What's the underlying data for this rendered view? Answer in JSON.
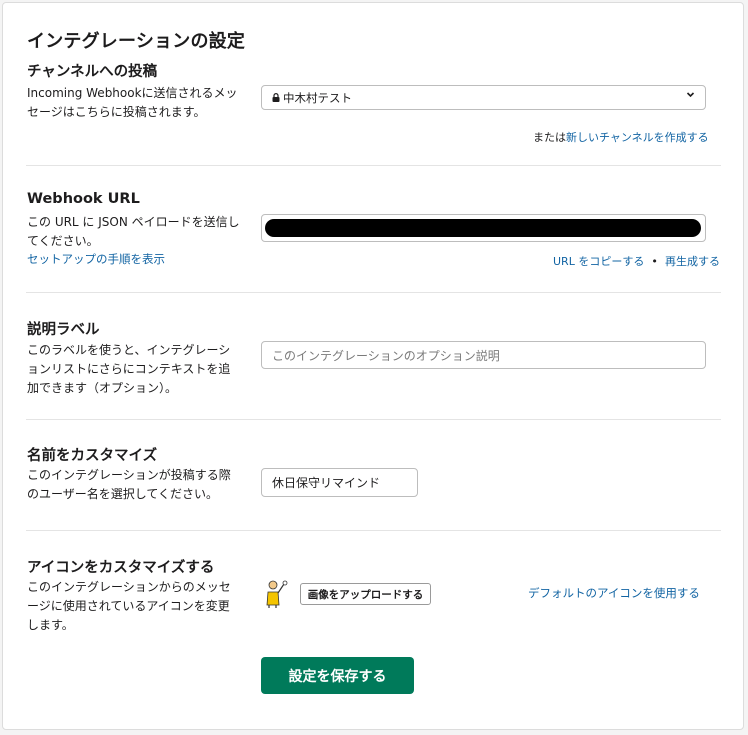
{
  "page_title": "インテグレーションの設定",
  "channel_section": {
    "title": "チャンネルへの投稿",
    "description_line1": "Incoming Webhookに送信されるメッ",
    "description_line2": "セージはこちらに投稿されます。",
    "selected_channel": "中木村テスト",
    "create_prefix": "または",
    "create_link": "新しいチャンネルを作成する"
  },
  "webhook_section": {
    "title": "Webhook URL",
    "description_line1": "この URL に JSON ペイロードを送信し",
    "description_line2": "てください。",
    "setup_link": "セットアップの手順を表示",
    "copy_link": "URL をコピーする",
    "separator": "•",
    "regenerate_link": "再生成する"
  },
  "label_section": {
    "title": "説明ラベル",
    "description_line1": "このラベルを使うと、インテグレーシ",
    "description_line2": "ョンリストにさらにコンテキストを追",
    "description_line3": "加できます（オプション）。",
    "placeholder": "このインテグレーションのオプション説明"
  },
  "name_section": {
    "title": "名前をカスタマイズ",
    "description_line1": "このインテグレーションが投稿する際",
    "description_line2": "のユーザー名を選択してください。",
    "value": "休日保守リマインド"
  },
  "icon_section": {
    "title": "アイコンをカスタマイズする",
    "description_line1": "このインテグレーションからのメッセ",
    "description_line2": "ージに使用されているアイコンを変更",
    "description_line3": "します。",
    "upload_button": "画像をアップロードする",
    "default_link": "デフォルトのアイコンを使用する"
  },
  "save_button": "設定を保存する",
  "colors": {
    "accent": "#007a5a",
    "link": "#1264a3"
  }
}
